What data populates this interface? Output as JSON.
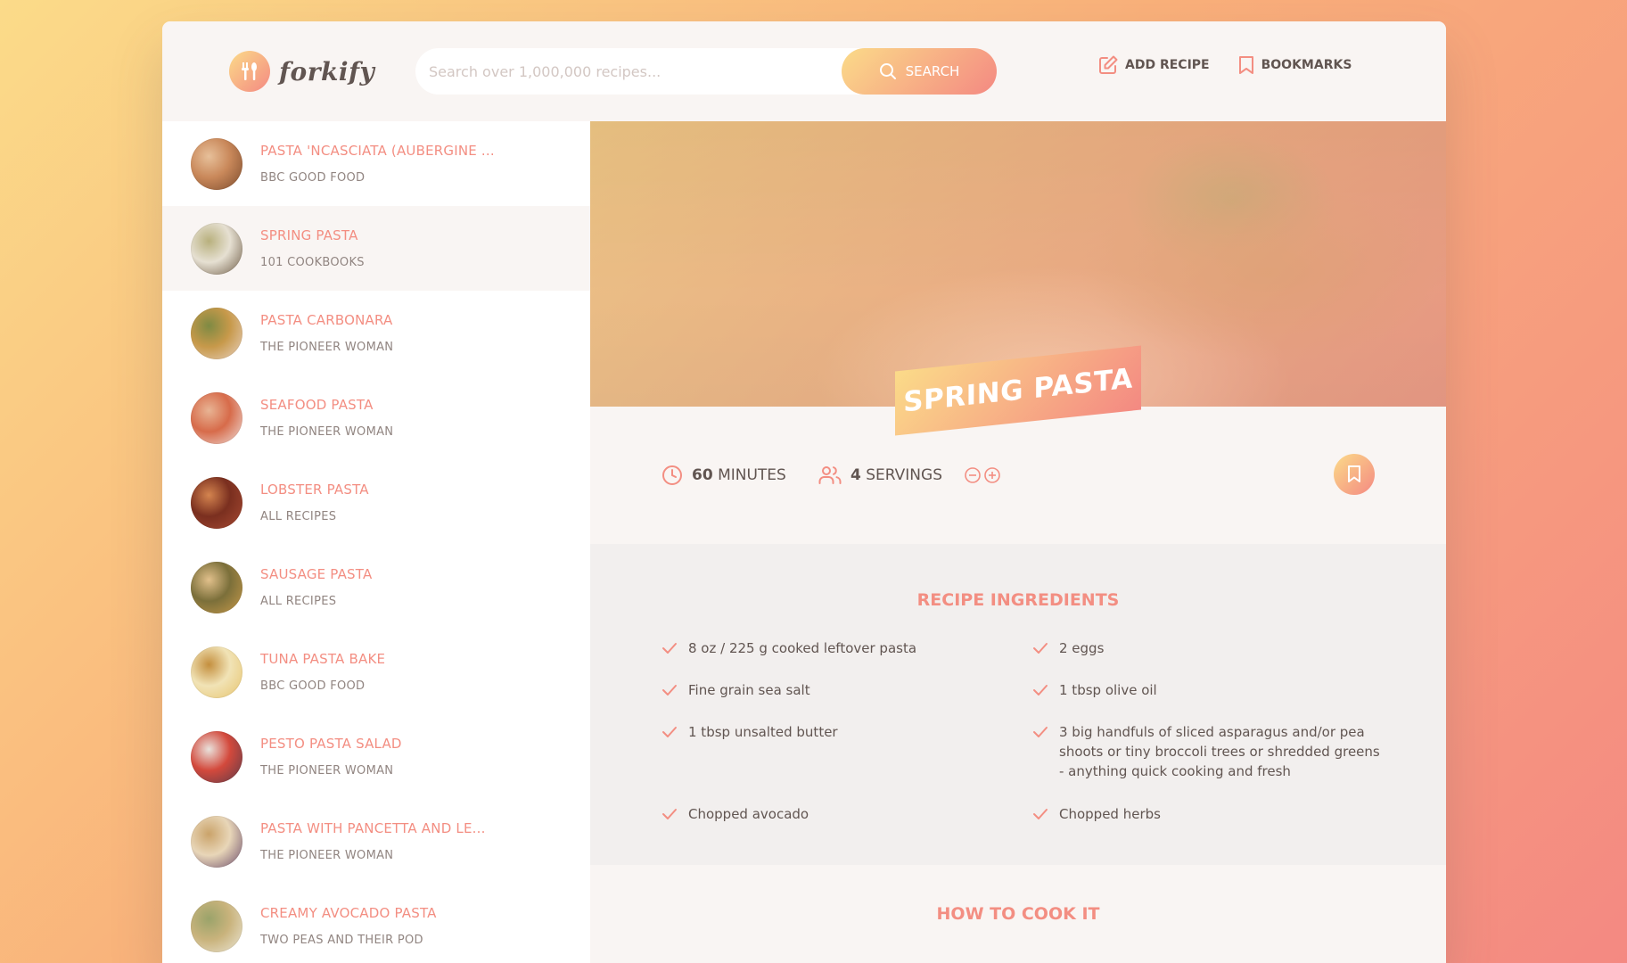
{
  "brand": {
    "logo_text": "forkify"
  },
  "search": {
    "placeholder": "Search over 1,000,000 recipes...",
    "button_label": "Search"
  },
  "nav": {
    "add_recipe": "Add recipe",
    "bookmarks": "Bookmarks"
  },
  "results": [
    {
      "title": "Pasta 'ncasciata (aubergine ...",
      "publisher": "BBC Good Food",
      "active": false,
      "thumb_colors": [
        "#7a4a2c",
        "#c9885a",
        "#e7c09a"
      ]
    },
    {
      "title": "Spring Pasta",
      "publisher": "101 Cookbooks",
      "active": true,
      "thumb_colors": [
        "#6d5a44",
        "#e6e0d2",
        "#b8b07d"
      ]
    },
    {
      "title": "Pasta Carbonara",
      "publisher": "The Pioneer Woman",
      "active": false,
      "thumb_colors": [
        "#e9d3c5",
        "#c7994a",
        "#7e8a43"
      ]
    },
    {
      "title": "Seafood Pasta",
      "publisher": "The Pioneer Woman",
      "active": false,
      "thumb_colors": [
        "#efe1dd",
        "#d76b4a",
        "#e8b494"
      ]
    },
    {
      "title": "Lobster Pasta",
      "publisher": "All Recipes",
      "active": false,
      "thumb_colors": [
        "#a84a33",
        "#7a2f1f",
        "#d4844f"
      ]
    },
    {
      "title": "Sausage Pasta",
      "publisher": "All Recipes",
      "active": false,
      "thumb_colors": [
        "#c99a4a",
        "#7b6f3a",
        "#e1c08b"
      ]
    },
    {
      "title": "Tuna Pasta Bake",
      "publisher": "BBC Good Food",
      "active": false,
      "thumb_colors": [
        "#e7c36b",
        "#f1e3b6",
        "#c48f3e"
      ]
    },
    {
      "title": "Pesto Pasta Salad",
      "publisher": "The Pioneer Woman",
      "active": false,
      "thumb_colors": [
        "#5a3b49",
        "#d3493c",
        "#e9e2dc"
      ]
    },
    {
      "title": "Pasta with Pancetta and Le...",
      "publisher": "The Pioneer Woman",
      "active": false,
      "thumb_colors": [
        "#6a4a6a",
        "#e8d6b8",
        "#caa36a"
      ]
    },
    {
      "title": "Creamy Avocado Pasta",
      "publisher": "Two Peas and Their Pod",
      "active": false,
      "thumb_colors": [
        "#ece7d8",
        "#c9b37c",
        "#9aa36a"
      ]
    }
  ],
  "recipe": {
    "title": "Spring Pasta",
    "cooking_time": "60",
    "cooking_time_unit": "minutes",
    "servings": "4",
    "servings_unit": "servings",
    "ingredients_heading": "Recipe ingredients",
    "ingredients": [
      "8 oz / 225 g cooked leftover pasta",
      "2 eggs",
      "Fine grain sea salt",
      "1 tbsp olive oil",
      "1 tbsp unsalted butter",
      "3 big handfuls of sliced asparagus and/or pea shoots or tiny broccoli trees or shredded greens - anything quick cooking and fresh",
      "Chopped avocado",
      "Chopped herbs"
    ],
    "directions_heading": "How to cook it"
  },
  "colors": {
    "accent": "#f38e82",
    "grad_start": "#fbdb89",
    "grad_end": "#f48982",
    "text": "#615551"
  }
}
